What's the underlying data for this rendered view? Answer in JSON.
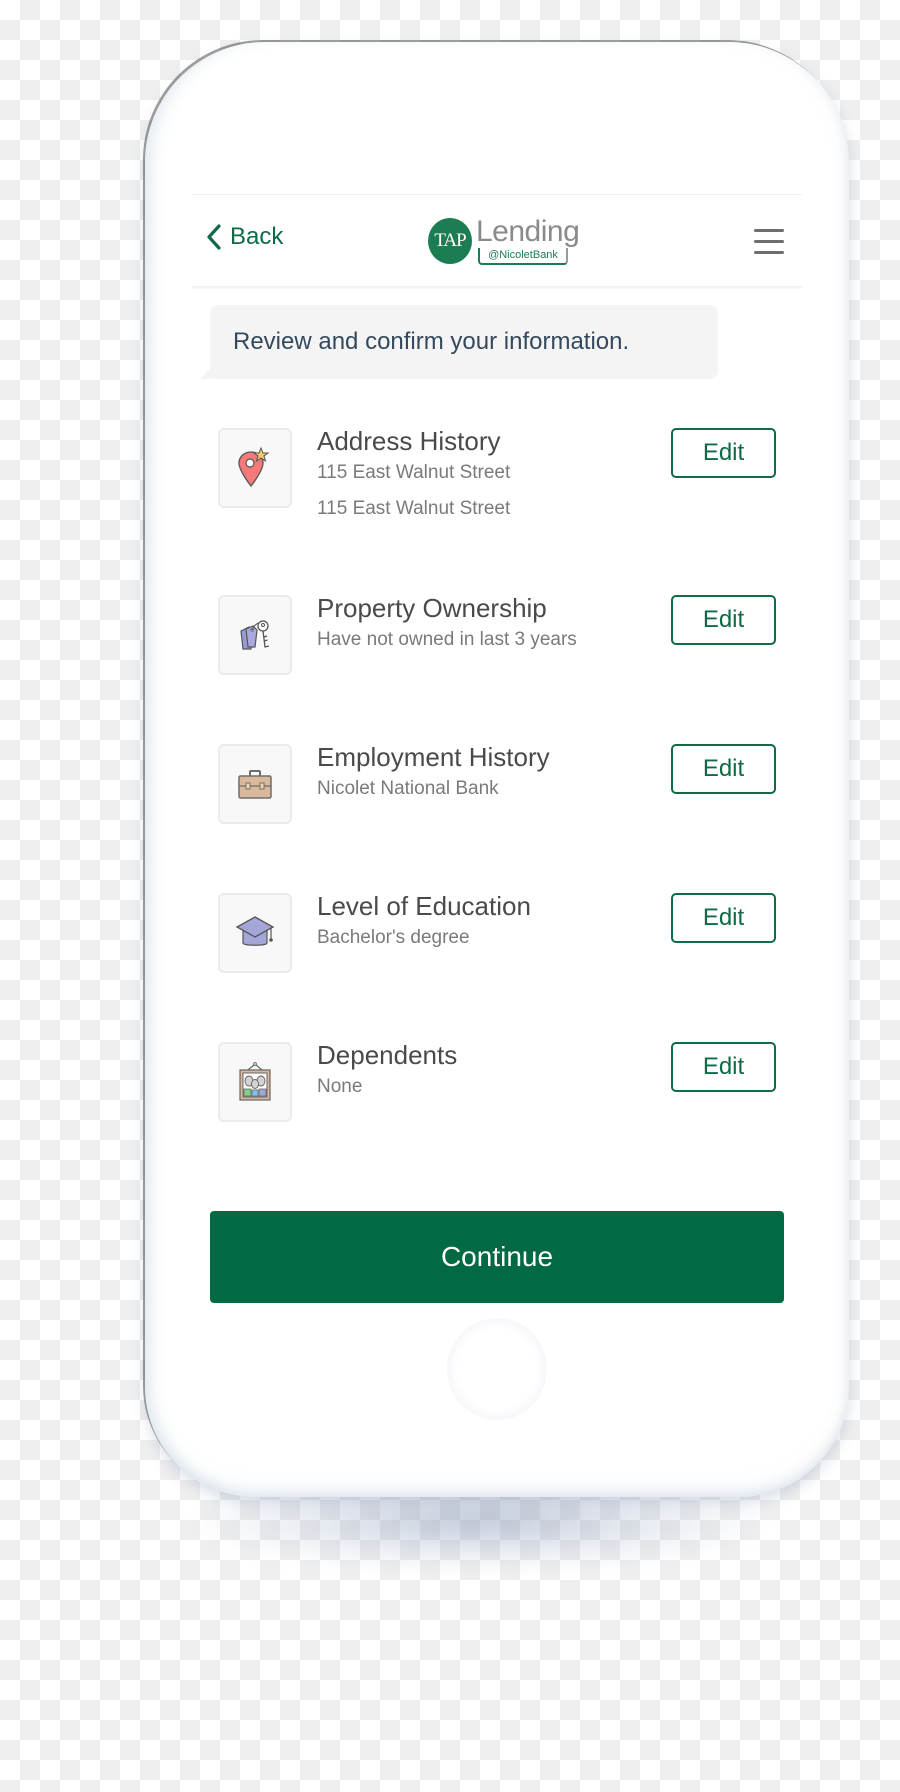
{
  "navbar": {
    "back_label": "Back",
    "logo": {
      "badge": "TAP",
      "wordmark": "Lending",
      "subtext": "@NicoletBank"
    },
    "menu_icon": "hamburger-menu-icon"
  },
  "prompt": {
    "text": "Review and confirm your information."
  },
  "items": [
    {
      "title": "Address History",
      "lines": [
        "115 East Walnut Street",
        "115 East Walnut Street"
      ],
      "icon": "map-pin-star-icon",
      "edit_label": "Edit"
    },
    {
      "title": "Property Ownership",
      "lines": [
        "Have not owned in last 3 years"
      ],
      "icon": "keys-tag-icon",
      "edit_label": "Edit"
    },
    {
      "title": "Employment History",
      "lines": [
        "Nicolet National Bank"
      ],
      "icon": "briefcase-icon",
      "edit_label": "Edit"
    },
    {
      "title": "Level of Education",
      "lines": [
        "Bachelor's degree"
      ],
      "icon": "graduation-cap-icon",
      "edit_label": "Edit"
    },
    {
      "title": "Dependents",
      "lines": [
        "None"
      ],
      "icon": "family-portrait-icon",
      "edit_label": "Edit"
    }
  ],
  "continue_label": "Continue",
  "colors": {
    "brand_green": "#016a43",
    "link_green": "#0f6b45",
    "prompt_text": "#34495e"
  }
}
